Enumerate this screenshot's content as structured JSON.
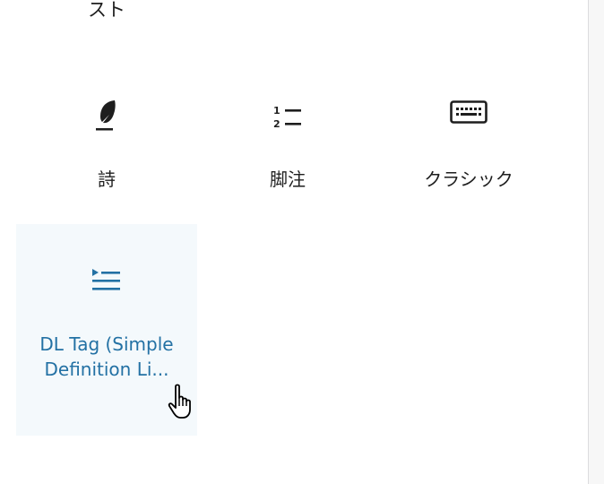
{
  "blocks": {
    "partial_label": "スト",
    "poem": {
      "label": "詩",
      "icon": "feather-pen-icon"
    },
    "footnote": {
      "label": "脚注",
      "icon": "numbered-footnote-icon"
    },
    "classic": {
      "label": "クラシック",
      "icon": "keyboard-icon"
    },
    "dl_tag": {
      "label": "DL Tag (Simple Definition Li...",
      "icon": "definition-list-icon"
    }
  },
  "colors": {
    "accent": "#2371a4",
    "hover_bg": "#f4f9fc",
    "text": "#1e1e1e"
  }
}
